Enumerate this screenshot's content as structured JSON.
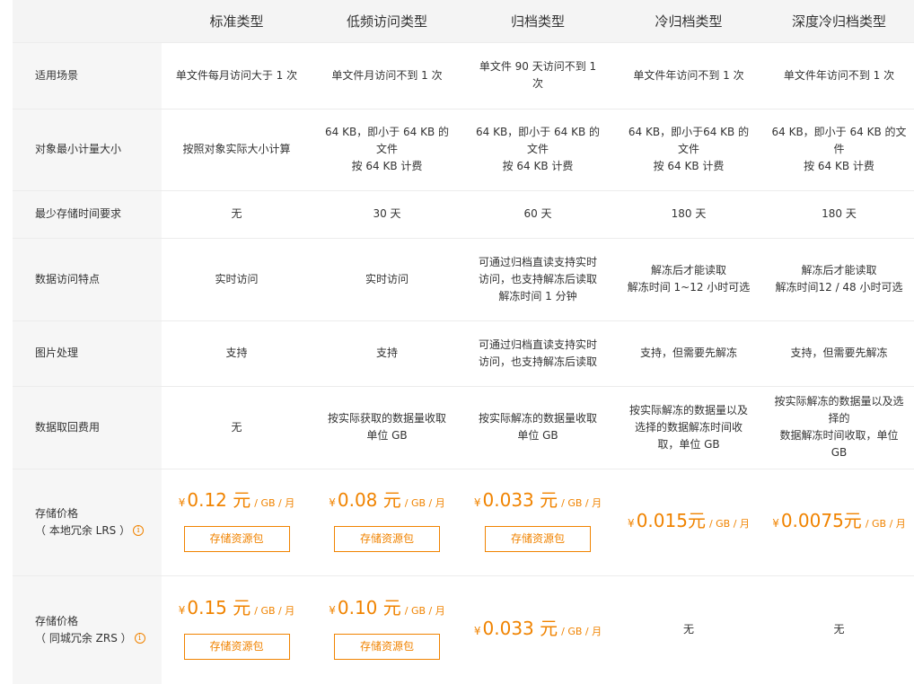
{
  "columns": [
    "标准类型",
    "低频访问类型",
    "归档类型",
    "冷归档类型",
    "深度冷归档类型"
  ],
  "accent_color": "#f08300",
  "rows": [
    {
      "label": "适用场景",
      "cells": [
        "单文件每月访问大于 1 次",
        "单文件月访问不到 1 次",
        "单文件 90 天访问不到 1\n次",
        "单文件年访问不到 1 次",
        "单文件年访问不到 1 次"
      ]
    },
    {
      "label": "对象最小计量大小",
      "cells": [
        "按照对象实际大小计算",
        "64 KB，即小于 64 KB 的\n文件\n按 64 KB 计费",
        "64 KB，即小于 64 KB 的\n文件\n按 64 KB 计费",
        "64 KB，即小于64 KB 的\n文件\n按 64 KB 计费",
        "64 KB，即小于 64 KB 的文件\n按 64 KB 计费"
      ]
    },
    {
      "label": "最少存储时间要求",
      "cells": [
        "无",
        "30 天",
        "60 天",
        "180 天",
        "180 天"
      ]
    },
    {
      "label": "数据访问特点",
      "cells": [
        "实时访问",
        "实时访问",
        "可通过归档直读支持实时\n访问，也支持解冻后读取\n解冻时间 1 分钟",
        "解冻后才能读取\n解冻时间 1~12 小时可选",
        "解冻后才能读取\n解冻时间12 / 48 小时可选"
      ]
    },
    {
      "label": "图片处理",
      "cells": [
        "支持",
        "支持",
        "可通过归档直读支持实时\n访问，也支持解冻后读取",
        "支持，但需要先解冻",
        "支持，但需要先解冻"
      ]
    },
    {
      "label": "数据取回费用",
      "cells": [
        "无",
        "按实际获取的数据量收取\n单位 GB",
        "按实际解冻的数据量收取\n单位 GB",
        "按实际解冻的数据量以及\n选择的数据解冻时间收\n取，单位 GB",
        "按实际解冻的数据量以及选择的\n数据解冻时间收取，单位 GB"
      ]
    }
  ],
  "price_rows": [
    {
      "label_line1": "存储价格",
      "label_line2": "（ 本地冗余 LRS ）",
      "cells": [
        {
          "currency": "¥",
          "amount": "0.12 元",
          "unit": "/ GB / 月",
          "button": "存储资源包"
        },
        {
          "currency": "¥",
          "amount": "0.08 元",
          "unit": "/ GB / 月",
          "button": "存储资源包"
        },
        {
          "currency": "¥",
          "amount": "0.033 元",
          "unit": "/ GB / 月",
          "button": "存储资源包"
        },
        {
          "currency": "¥",
          "amount": "0.015元",
          "unit": "/ GB / 月"
        },
        {
          "currency": "¥",
          "amount": "0.0075元",
          "unit": "/ GB / 月"
        }
      ]
    },
    {
      "label_line1": "存储价格",
      "label_line2": "（ 同城冗余 ZRS ）",
      "cells": [
        {
          "currency": "¥",
          "amount": "0.15 元",
          "unit": "/ GB / 月",
          "button": "存储资源包"
        },
        {
          "currency": "¥",
          "amount": "0.10 元",
          "unit": "/ GB / 月",
          "button": "存储资源包"
        },
        {
          "currency": "¥",
          "amount": "0.033 元",
          "unit": "/ GB / 月"
        },
        {
          "text": "无"
        },
        {
          "text": "无"
        }
      ]
    }
  ],
  "info_icon": "i"
}
